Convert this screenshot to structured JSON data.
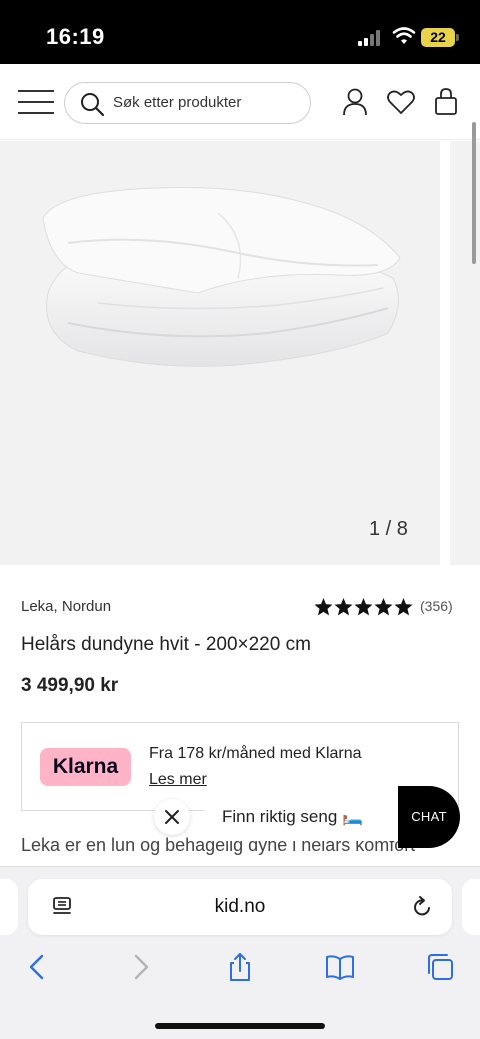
{
  "status_bar": {
    "time": "16:19",
    "battery": "22"
  },
  "header": {
    "search_placeholder": "Søk etter produkter"
  },
  "gallery": {
    "counter": "1 / 8"
  },
  "product": {
    "brand": "Leka, Nordun",
    "rating_stars": 5,
    "review_count": "(356)",
    "title": "Helårs dundyne hvit - 200×220 cm",
    "price": "3 499,90 kr"
  },
  "klarna": {
    "badge": "Klarna",
    "text": "Fra 178 kr/måned med Klarna",
    "link": "Les mer"
  },
  "chat": {
    "prompt": "Finn riktig seng 🛏️",
    "button": "CHAT"
  },
  "description": {
    "text": "Leka er en lun og behagelig dyne i helårs komfort -"
  },
  "browser": {
    "url": "kid.no"
  },
  "colors": {
    "klarna_pink": "#ffb3c7",
    "chat_black": "#000000",
    "battery_yellow": "#e8d34a"
  }
}
